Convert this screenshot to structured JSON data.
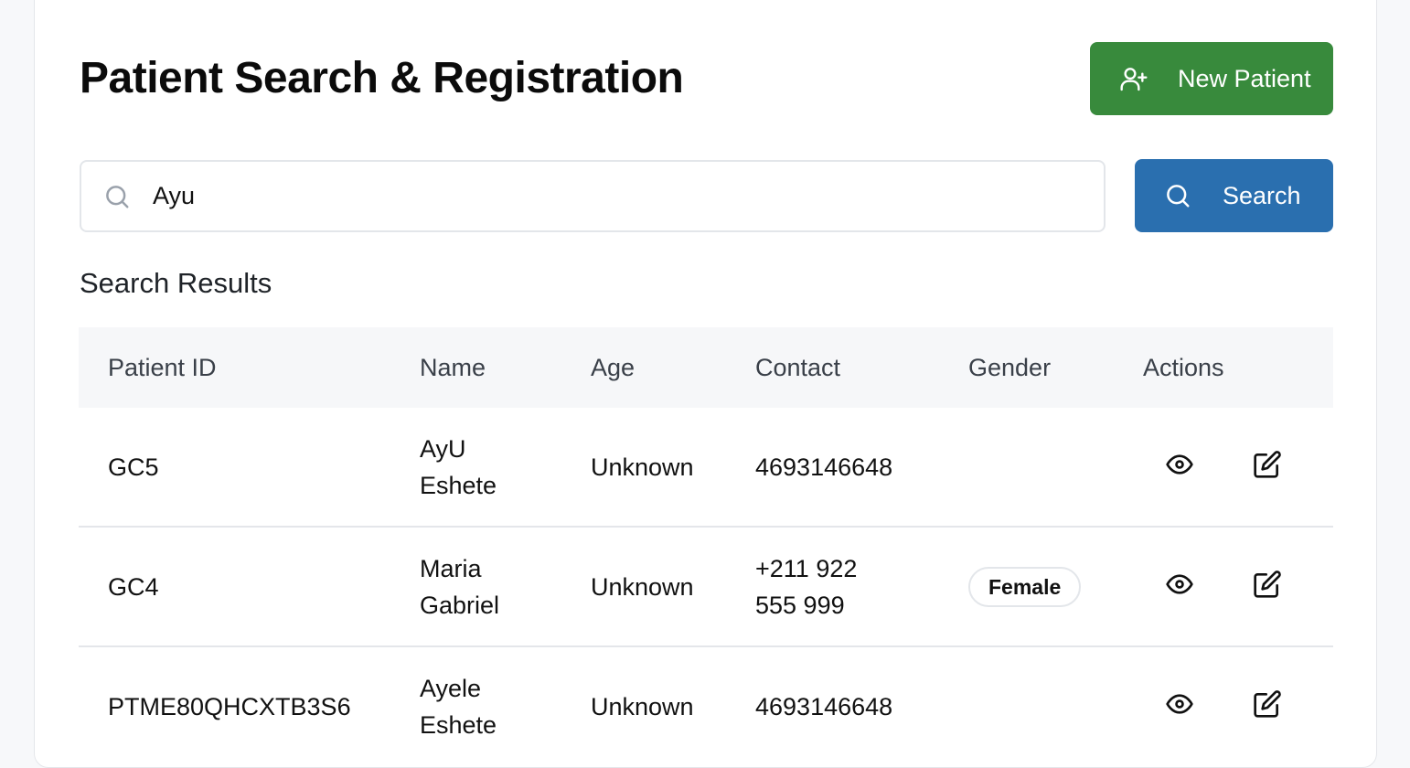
{
  "header": {
    "title": "Patient Search & Registration",
    "new_patient_label": "New Patient"
  },
  "search": {
    "value": "Ayu",
    "button_label": "Search"
  },
  "results": {
    "title": "Search Results",
    "columns": [
      "Patient ID",
      "Name",
      "Age",
      "Contact",
      "Gender",
      "Actions"
    ],
    "rows": [
      {
        "id": "GC5",
        "name": "AyU Eshete",
        "age": "Unknown",
        "contact": "4693146648",
        "gender": ""
      },
      {
        "id": "GC4",
        "name": "Maria Gabriel",
        "age": "Unknown",
        "contact": "+211 922 555 999",
        "gender": "Female"
      },
      {
        "id": "PTME80QHCXTB3S6",
        "name": "Ayele Eshete",
        "age": "Unknown",
        "contact": "4693146648",
        "gender": ""
      }
    ]
  },
  "icons": {
    "new_patient": "user-plus-icon",
    "search": "search-icon",
    "view": "eye-icon",
    "edit": "edit-icon"
  },
  "colors": {
    "new_patient_button": "#388a3c",
    "search_button": "#2a6faf"
  }
}
